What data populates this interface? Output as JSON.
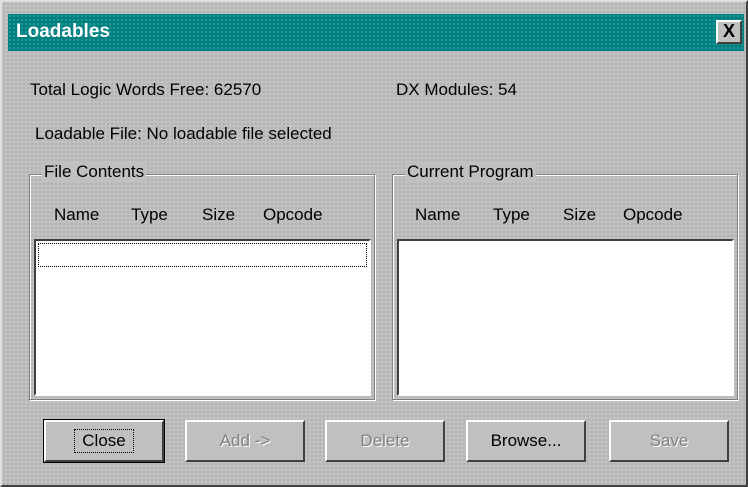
{
  "window": {
    "title": "Loadables",
    "close_label": "X"
  },
  "info": {
    "logic_words_free": "Total Logic Words Free: 62570",
    "dx_modules": "DX Modules: 54",
    "loadable_file": "Loadable File: No loadable file selected"
  },
  "file_contents": {
    "title": "File Contents",
    "columns": [
      "Name",
      "Type",
      "Size",
      "Opcode"
    ],
    "rows": []
  },
  "current_program": {
    "title": "Current Program",
    "columns": [
      "Name",
      "Type",
      "Size",
      "Opcode"
    ],
    "rows": []
  },
  "buttons": {
    "close": "Close",
    "add": "Add ->",
    "delete": "Delete",
    "browse": "Browse...",
    "save": "Save"
  },
  "colors": {
    "face": "#c0c0c0",
    "title_bar": "#008080",
    "title_text": "#ffffff",
    "disabled_text": "#808080"
  }
}
